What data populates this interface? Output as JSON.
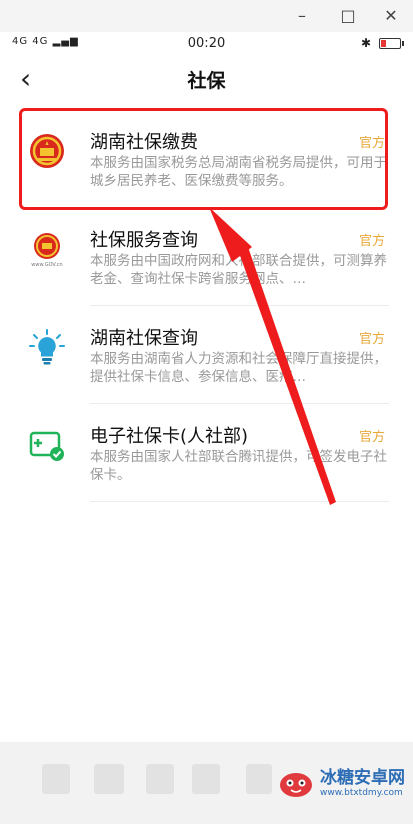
{
  "window": {
    "minimize": "–",
    "maximize": "□",
    "close": "✕"
  },
  "status_bar": {
    "signal": "4G 4G",
    "time": "00:20"
  },
  "nav": {
    "back": "‹",
    "title": "社保"
  },
  "items": [
    {
      "title": "湖南社保缴费",
      "badge": "官方",
      "desc": "本服务由国家税务总局湖南省税务局提供，可用于城乡居民养老、医保缴费等服务。",
      "icon": "national-emblem-icon"
    },
    {
      "title": "社保服务查询",
      "badge": "官方",
      "desc": "本服务由中国政府网和人社部联合提供，可测算养老金、查询社保卡跨省服务网点、…",
      "icon": "gov-emblem-icon"
    },
    {
      "title": "湖南社保查询",
      "badge": "官方",
      "desc": "本服务由湖南省人力资源和社会保障厅直接提供，提供社保卡信息、参保信息、医疗…",
      "icon": "lightbulb-icon"
    },
    {
      "title": "电子社保卡(人社部)",
      "badge": "官方",
      "desc": "本服务由国家人社部联合腾讯提供，可签发电子社保卡。",
      "icon": "ecard-icon"
    }
  ],
  "watermark": {
    "name": "冰糖安卓网",
    "url": "www.btxtdmy.com"
  },
  "colors": {
    "highlight": "#ee1c1c",
    "badge": "#e8a93a",
    "arrow": "#ee1c1c"
  }
}
